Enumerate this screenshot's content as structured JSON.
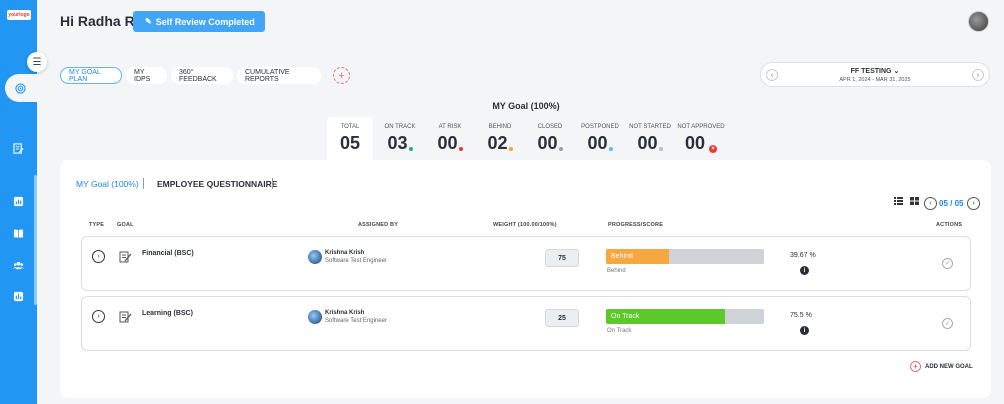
{
  "app": {
    "logo_text": "yourlogo"
  },
  "header": {
    "greeting": "Hi Radha R",
    "review_button": "Self Review Completed"
  },
  "tabs": [
    {
      "label": "MY GOAL PLAN"
    },
    {
      "label": "MY IDPS"
    },
    {
      "label": "360° FEEDBACK"
    },
    {
      "label": "CUMULATIVE REPORTS"
    }
  ],
  "period": {
    "name": "FF TESTING",
    "range": "APR 1, 2024 - MAR 31, 2025"
  },
  "goal_summary": {
    "title": "MY Goal (100%)",
    "stats": [
      {
        "label": "TOTAL",
        "value": "05",
        "color": ""
      },
      {
        "label": "ON TRACK",
        "value": "03",
        "color": "#26a69a"
      },
      {
        "label": "AT RISK",
        "value": "00",
        "color": "#e53935"
      },
      {
        "label": "BEHIND",
        "value": "02",
        "color": "#f5a623"
      },
      {
        "label": "CLOSED",
        "value": "00",
        "color": "#9e9e9e"
      },
      {
        "label": "POSTPONED",
        "value": "00",
        "color": "#4fc3f7"
      },
      {
        "label": "NOT STARTED",
        "value": "00",
        "color": "#bdbdbd"
      },
      {
        "label": "NOT APPROVED",
        "value": "00",
        "color": "#e53935"
      }
    ]
  },
  "subtabs": [
    {
      "label": "MY Goal (100%)"
    },
    {
      "label": "EMPLOYEE QUESTIONNAIRE"
    }
  ],
  "pager": {
    "text": "05 / 05"
  },
  "table": {
    "headers": {
      "type": "TYPE",
      "goal": "GOAL",
      "assigned_by": "ASSIGNED BY",
      "weight": "WEIGHT (100.00/100%)",
      "progress": "PROGRESS/SCORE",
      "actions": "ACTIONS"
    },
    "rows": [
      {
        "goal": "Financial (BSC)",
        "assignee_name": "Krishna Krish",
        "assignee_role": "Software Test Engineer",
        "weight": "75",
        "status": "Behind",
        "status_sub": "Behind",
        "progress": 0.3967,
        "bar_color": "#f5a742",
        "score": "39.67  %"
      },
      {
        "goal": "Learning (BSC)",
        "assignee_name": "Krishna Krish",
        "assignee_role": "Software Test Engineer",
        "weight": "25",
        "status": "On Track",
        "status_sub": "On Track",
        "progress": 0.755,
        "bar_color": "#5cc82a",
        "score": "75.5  %"
      }
    ]
  },
  "add_goal": "ADD NEW GOAL"
}
